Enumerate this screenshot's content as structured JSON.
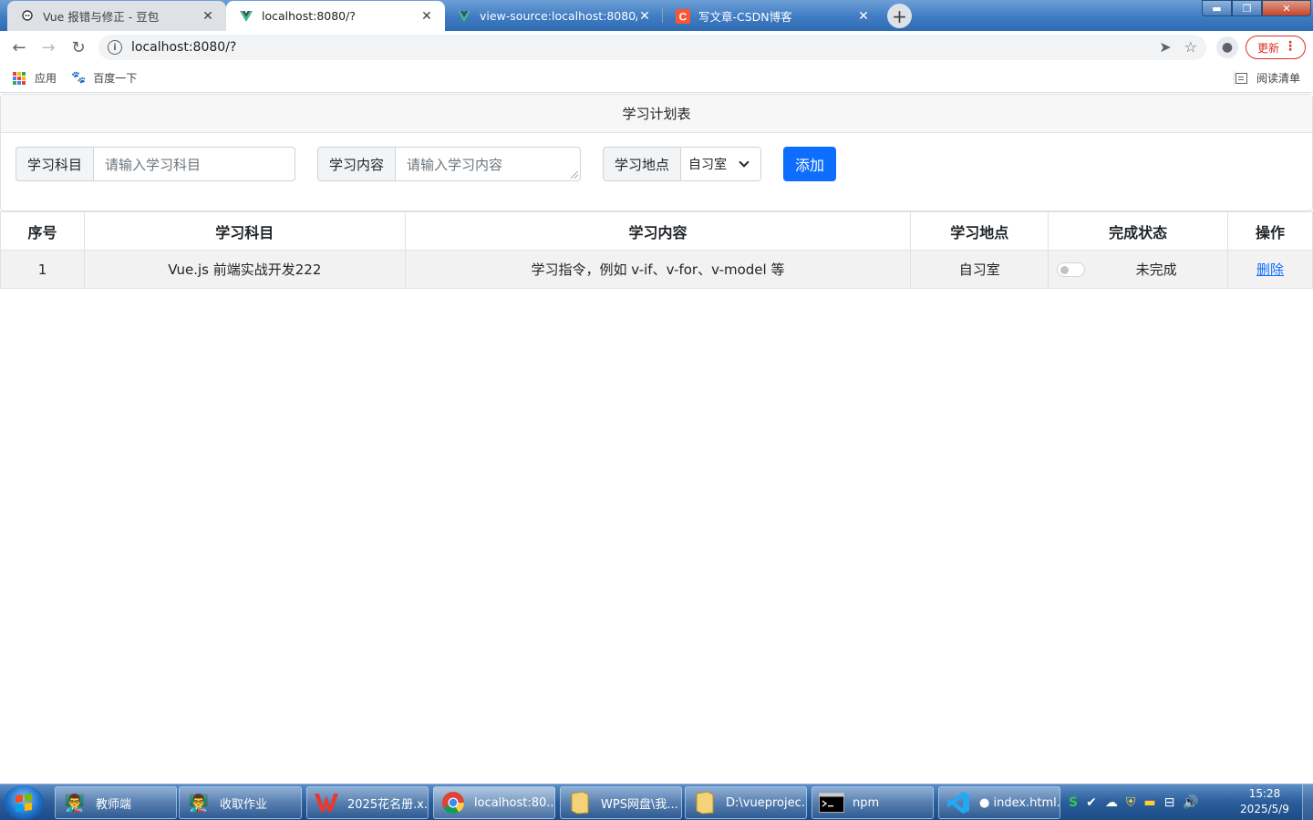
{
  "browser": {
    "tabs": [
      {
        "title": "Vue 报错与修正 - 豆包",
        "icon": "doubao-icon"
      },
      {
        "title": "localhost:8080/?",
        "icon": "vue-icon"
      },
      {
        "title": "view-source:localhost:8080/?",
        "icon": "vue-icon"
      },
      {
        "title": "写文章-CSDN博客",
        "icon": "csdn-icon"
      }
    ],
    "url": "localhost:8080/?",
    "update_label": "更新",
    "bookmarks": [
      {
        "label": "应用"
      },
      {
        "label": "百度一下"
      }
    ],
    "reading_list": "阅读清单"
  },
  "page": {
    "card_title": "学习计划表",
    "form": {
      "subject_label": "学习科目",
      "subject_placeholder": "请输入学习科目",
      "content_label": "学习内容",
      "content_placeholder": "请输入学习内容",
      "location_label": "学习地点",
      "location_value": "自习室",
      "add_label": "添加"
    },
    "table": {
      "headers": [
        "序号",
        "学习科目",
        "学习内容",
        "学习地点",
        "完成状态",
        "操作"
      ],
      "rows": [
        {
          "index": "1",
          "subject": "Vue.js 前端实战开发222",
          "content": "学习指令，例如 v-if、v-for、v-model 等",
          "location": "自习室",
          "status": "未完成",
          "action": "删除"
        }
      ]
    }
  },
  "taskbar": {
    "items": [
      {
        "label": "教师端"
      },
      {
        "label": "收取作业"
      },
      {
        "label": "2025花名册.x..."
      },
      {
        "label": "localhost:80..."
      },
      {
        "label": "WPS网盘\\我..."
      },
      {
        "label": "D:\\vueprojec..."
      },
      {
        "label": "npm"
      },
      {
        "label": "● index.html..."
      }
    ],
    "time": "15:28",
    "date": "2025/5/9"
  },
  "colors": {
    "primary": "#0d6efd",
    "update_red": "#d93025",
    "taskbar_blue": "#2a5d9a"
  }
}
